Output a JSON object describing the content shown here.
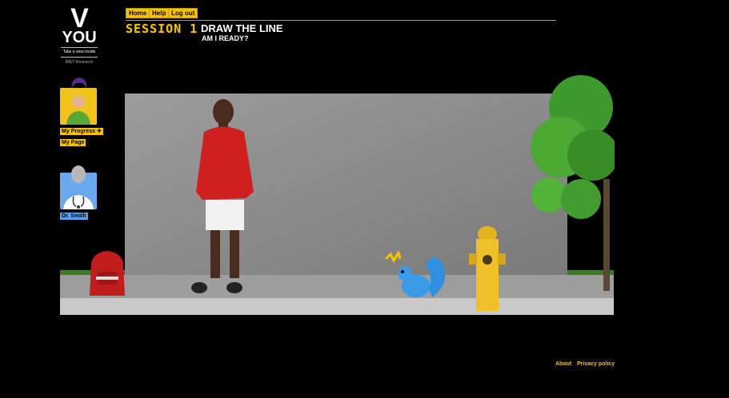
{
  "brand": {
    "logo_v": "V",
    "logo_you": "YOU",
    "tagline": "Take a view inside",
    "org": "IMET Research"
  },
  "nav": {
    "home": "Home",
    "help": "Help",
    "logout": "Log out"
  },
  "header": {
    "session_label": "SESSION 1",
    "title": "DRAW THE LINE",
    "subtitle": "AM I READY?"
  },
  "sidebar": {
    "my_progress": "My Progress",
    "my_progress_icon": "plus-icon",
    "my_page": "My Page",
    "counselor_name": "Dr. Smith"
  },
  "footer": {
    "about": "About",
    "privacy": "Privacy policy"
  },
  "colors": {
    "accent_yellow": "#f5c400",
    "counselor_blue": "#5aa0f0",
    "background": "#000000"
  }
}
